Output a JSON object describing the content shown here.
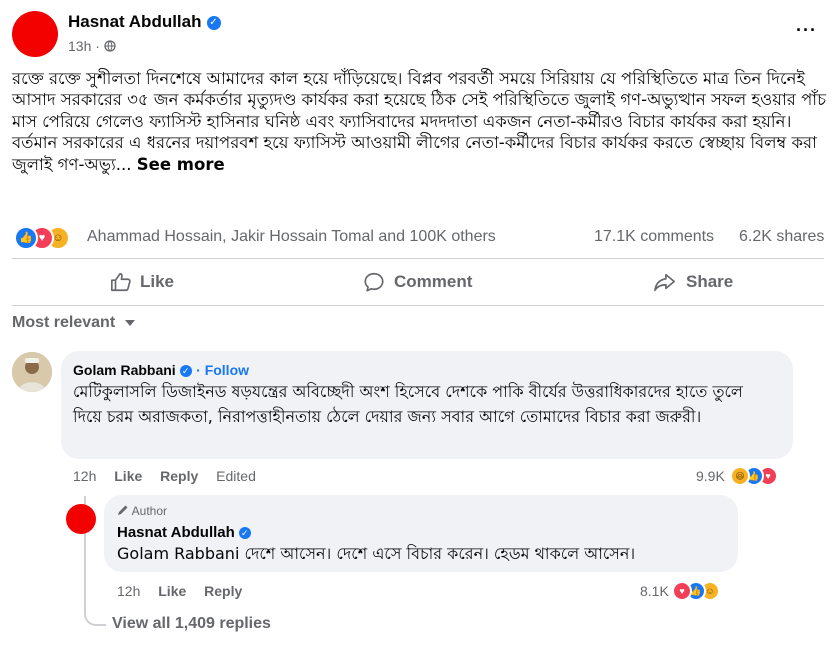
{
  "post": {
    "author": "Hasnat Abdullah",
    "time": "13h ·",
    "text": "রক্তে রক্তে সুশীলতা দিনশেষে আমাদের কাল হয়ে দাঁড়িয়েছে। বিপ্লব পরবর্তী সময়ে সিরিয়ায় যে পরিস্থিতিতে মাত্র তিন দিনেই আসাদ সরকারের ৩৫ জন কর্মকর্তার মৃত্যুদণ্ড কার্যকর করা হয়েছে ঠিক সেই পরিস্থিতিতে জুলাই গণ-অভ্যুত্থান সফল হওয়ার পাঁচ মাস পেরিয়ে গেলেও ফ্যাসিস্ট হাসিনার ঘনিষ্ঠ এবং ফ্যাসিবাদের মদদদাতা একজন নেতা-কর্মীরও বিচার কার্যকর করা হয়নি। বর্তমান সরকারের এ ধরনের দয়াপরবশ হয়ে ফ্যাসিস্ট আওয়ামী লীগের নেতা-কর্মীদের বিচার কার্যকর করতে স্বেচ্ছায় বিলম্ব করা জুলাই গণ-অভ্যু...",
    "see_more": "See more",
    "reactions_names": "Ahammad Hossain, Jakir Hossain Tomal and 100K others",
    "comments_count": "17.1K comments",
    "shares_count": "6.2K shares"
  },
  "actions": {
    "like": "Like",
    "comment": "Comment",
    "share": "Share"
  },
  "sort_label": "Most relevant",
  "comment1": {
    "author": "Golam Rabbani",
    "follow": "· Follow",
    "text": "মেটিকুলাসলি ডিজাইনড ষড়যন্ত্রের অবিচ্ছেদী অংশ হিসেবে দেশকে পাকি বীর্যের উত্তরাধিকারদের হাতে তুলে দিয়ে চরম অরাজকতা, নিরাপত্তাহীনতায় ঠেলে দেয়ার জন্য সবার আগে তোমাদের বিচার করা জরুরী।",
    "time": "12h",
    "like": "Like",
    "reply": "Reply",
    "edited": "Edited",
    "reaction_count": "9.9K"
  },
  "reply1": {
    "tag": "Author",
    "author": "Hasnat Abdullah",
    "text": "Golam Rabbani দেশে আসেন। দেশে এসে বিচার করেন। হেডম থাকলে আসেন।",
    "time": "12h",
    "like": "Like",
    "reply": "Reply",
    "reaction_count": "8.1K"
  },
  "view_all": "View all 1,409 replies",
  "colors": {
    "brand_blue": "#1877f2",
    "love_red": "#f33e58",
    "haha_yellow": "#f7b125",
    "avatar_red": "#f30000"
  }
}
